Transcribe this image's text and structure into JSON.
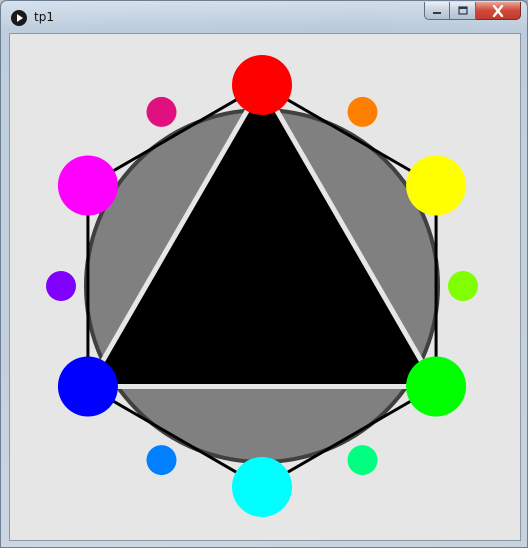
{
  "window": {
    "title": "tp1",
    "app_icon": "processing-play-icon",
    "controls": {
      "minimize": "minimize-icon",
      "maximize": "maximize-icon",
      "close": "close-icon"
    }
  },
  "canvas": {
    "background": "#e6e6e6",
    "disc_fill": "#808080",
    "disc_stroke": "#404040",
    "triangle_fill": "#000000",
    "triangle_outline": "#e6e6e6",
    "hexagon_stroke": "#000000",
    "color_wheel": [
      {
        "name": "red",
        "color": "#ff0000",
        "size": "large"
      },
      {
        "name": "orange",
        "color": "#ff8000",
        "size": "small"
      },
      {
        "name": "yellow",
        "color": "#ffff00",
        "size": "large"
      },
      {
        "name": "chartreuse",
        "color": "#80ff00",
        "size": "small"
      },
      {
        "name": "green",
        "color": "#00ff00",
        "size": "large"
      },
      {
        "name": "spring-green",
        "color": "#00ff80",
        "size": "small"
      },
      {
        "name": "cyan",
        "color": "#00ffff",
        "size": "large"
      },
      {
        "name": "azure",
        "color": "#0080ff",
        "size": "small"
      },
      {
        "name": "blue",
        "color": "#0000ff",
        "size": "large"
      },
      {
        "name": "violet",
        "color": "#8000ff",
        "size": "small"
      },
      {
        "name": "magenta",
        "color": "#ff00ff",
        "size": "large"
      },
      {
        "name": "rose",
        "color": "#e0107f",
        "size": "small"
      }
    ]
  }
}
